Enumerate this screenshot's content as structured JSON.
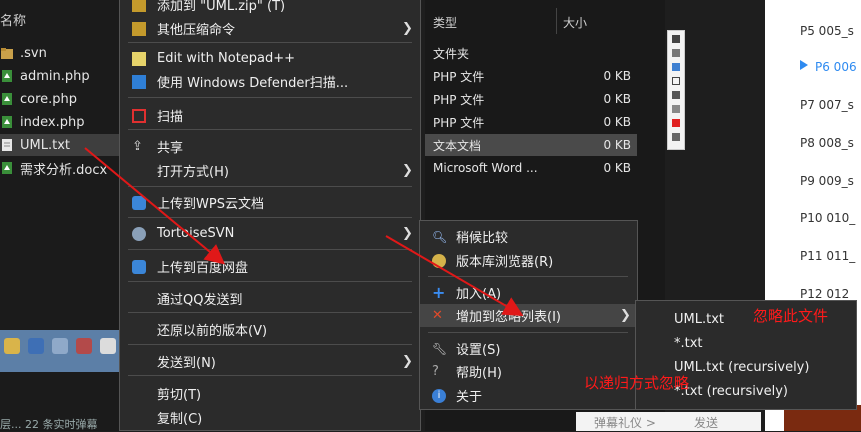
{
  "explorer": {
    "header": "名称",
    "files": [
      {
        "name": ".svn",
        "icon": "folder-icon",
        "selected": false
      },
      {
        "name": "admin.php",
        "icon": "php-file-icon",
        "selected": false
      },
      {
        "name": "core.php",
        "icon": "php-file-icon",
        "selected": false
      },
      {
        "name": "index.php",
        "icon": "php-file-icon",
        "selected": false
      },
      {
        "name": "UML.txt",
        "icon": "text-file-icon",
        "selected": true
      },
      {
        "name": "需求分析.docx",
        "icon": "word-file-icon",
        "selected": false
      }
    ],
    "bottom_text": "层... 22 条实时弹幕"
  },
  "columns": {
    "type_header": "类型",
    "size_header": "大小",
    "rows": [
      {
        "type": "文件夹",
        "size": ""
      },
      {
        "type": "PHP 文件",
        "size": "0 KB"
      },
      {
        "type": "PHP 文件",
        "size": "0 KB"
      },
      {
        "type": "PHP 文件",
        "size": "0 KB"
      },
      {
        "type": "文本文档",
        "size": "0 KB",
        "selected": true
      },
      {
        "type": "Microsoft Word ...",
        "size": "0 KB"
      }
    ]
  },
  "context_menu": {
    "items": [
      {
        "label": "添加到 \"UML.zip\" (T)",
        "icon": "archive-icon"
      },
      {
        "label": "其他压缩命令",
        "icon": "archive-icon",
        "submenu": true
      },
      {
        "label": "Edit with Notepad++",
        "icon": "notepad-icon"
      },
      {
        "label": "使用 Windows Defender扫描...",
        "icon": "defender-shield-icon"
      },
      {
        "label": "扫描",
        "icon": "scan-shield-icon"
      },
      {
        "label": "共享",
        "icon": "share-icon"
      },
      {
        "label": "打开方式(H)",
        "icon": "",
        "submenu": true
      },
      {
        "label": "上传到WPS云文档",
        "icon": "wps-cloud-icon"
      },
      {
        "label": "TortoiseSVN",
        "icon": "tortoise-icon",
        "submenu": true
      },
      {
        "label": "上传到百度网盘",
        "icon": "baidu-cloud-icon"
      },
      {
        "label": "通过QQ发送到",
        "icon": ""
      },
      {
        "label": "还原以前的版本(V)",
        "icon": ""
      },
      {
        "label": "发送到(N)",
        "icon": "",
        "submenu": true
      },
      {
        "label": "剪切(T)",
        "icon": ""
      },
      {
        "label": "复制(C)",
        "icon": ""
      }
    ]
  },
  "svn_menu": {
    "items": [
      {
        "label": "稍候比较",
        "icon": "compare-icon"
      },
      {
        "label": "版本库浏览器(R)",
        "icon": "repo-browser-icon"
      },
      {
        "label": "加入(A)",
        "icon": "add-icon"
      },
      {
        "label": "增加到忽略列表(I)",
        "icon": "ignore-icon",
        "submenu": true,
        "highlighted": true
      },
      {
        "label": "设置(S)",
        "icon": "wrench-icon"
      },
      {
        "label": "帮助(H)",
        "icon": "help-icon"
      },
      {
        "label": "关于",
        "icon": "info-icon"
      }
    ]
  },
  "ignore_menu": {
    "items": [
      {
        "label": "UML.txt"
      },
      {
        "label": "*.txt"
      },
      {
        "label": "UML.txt (recursively)"
      },
      {
        "label": "*.txt (recursively)"
      }
    ]
  },
  "annotations": {
    "ignore_this_file": "忽略此文件",
    "ignore_recursively": "以递归方式忽略"
  },
  "playlist": {
    "items": [
      {
        "label": "P5  005_s",
        "active": false
      },
      {
        "label": "P6  006",
        "active": true
      },
      {
        "label": "P7  007_s",
        "active": false
      },
      {
        "label": "P8  008_s",
        "active": false
      },
      {
        "label": "P9  009_s",
        "active": false
      },
      {
        "label": "P10  010_",
        "active": false
      },
      {
        "label": "P11  011_",
        "active": false
      },
      {
        "label": "P12  012_",
        "active": false
      }
    ],
    "gift_label": "弹幕礼仪 >",
    "send_label": "发送"
  },
  "colors": {
    "annotation": "#ff1a1a",
    "accent": "#2e8af0"
  }
}
